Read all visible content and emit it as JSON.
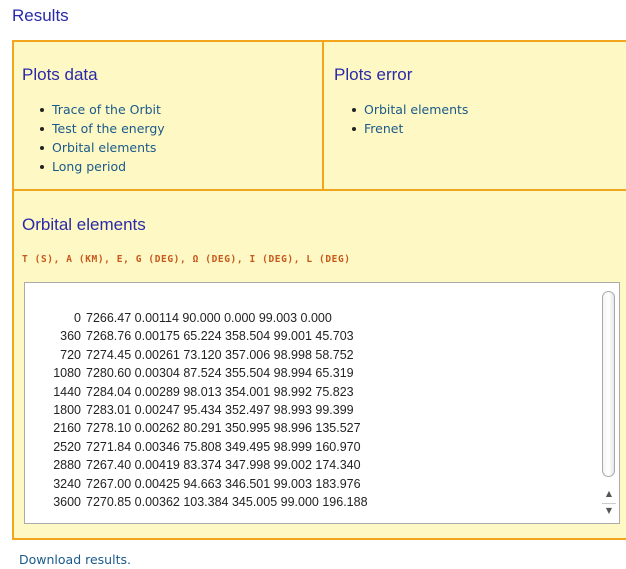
{
  "header": {
    "title": "Results"
  },
  "plots_data": {
    "title": "Plots data",
    "links": [
      {
        "label": "Trace of the Orbit"
      },
      {
        "label": "Test of the energy"
      },
      {
        "label": "Orbital elements"
      },
      {
        "label": "Long period"
      }
    ]
  },
  "plots_error": {
    "title": "Plots error",
    "links": [
      {
        "label": "Orbital elements"
      },
      {
        "label": "Frenet"
      }
    ]
  },
  "orbital": {
    "title": "Orbital elements",
    "columns_header": "T (S), A (KM), E, G (DEG), Ω (DEG), I (DEG), L (DEG)",
    "rows": [
      {
        "t": "0",
        "rest": "7266.47 0.00114 90.000 0.000 99.003 0.000"
      },
      {
        "t": "360",
        "rest": "7268.76 0.00175 65.224 358.504 99.001 45.703"
      },
      {
        "t": "720",
        "rest": "7274.45 0.00261 73.120 357.006 98.998 58.752"
      },
      {
        "t": "1080",
        "rest": "7280.60 0.00304 87.524 355.504 98.994 65.319"
      },
      {
        "t": "1440",
        "rest": "7284.04 0.00289 98.013 354.001 98.992 75.823"
      },
      {
        "t": "1800",
        "rest": "7283.01 0.00247 95.434 352.497 98.993 99.399"
      },
      {
        "t": "2160",
        "rest": "7278.10 0.00262 80.291 350.995 98.996 135.527"
      },
      {
        "t": "2520",
        "rest": "7271.84 0.00346 75.808 349.495 98.999 160.970"
      },
      {
        "t": "2880",
        "rest": "7267.40 0.00419 83.374 347.998 99.002 174.340"
      },
      {
        "t": "3240",
        "rest": "7267.00 0.00425 94.663 346.501 99.003 183.976"
      },
      {
        "t": "3600",
        "rest": "7270.85 0.00362 103.384 345.005 99.000 196.188"
      }
    ]
  },
  "footer": {
    "download_label": "Download results."
  },
  "icons": {
    "scroll_up": "scroll-up-arrow-icon",
    "scroll_down": "scroll-down-arrow-icon"
  },
  "colors": {
    "panel_background": "#fdf8c4",
    "panel_border": "#f2a61d",
    "heading": "#2a2aa8",
    "link": "#1a5a8a",
    "column_header": "#c8581c"
  }
}
